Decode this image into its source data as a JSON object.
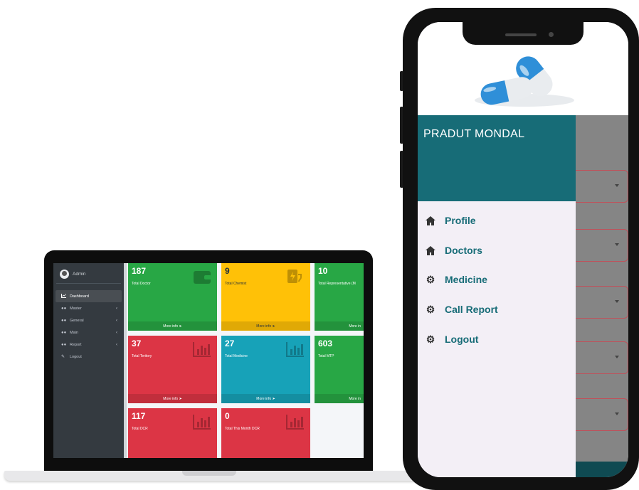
{
  "laptop": {
    "sidebar": {
      "user": "Admin",
      "items": [
        {
          "label": "Dashboard",
          "icon": "chart-icon",
          "active": true
        },
        {
          "label": "Master",
          "icon": "users-icon"
        },
        {
          "label": "General",
          "icon": "users-icon"
        },
        {
          "label": "Main",
          "icon": "users-icon"
        },
        {
          "label": "Report",
          "icon": "users-icon"
        },
        {
          "label": "Logout",
          "icon": "edit-icon"
        }
      ]
    },
    "boxes": [
      {
        "value": "187",
        "label": "Total Doctor",
        "more": "More info",
        "color": "#28a745",
        "icon": "wallet-icon"
      },
      {
        "value": "9",
        "label": "Total Chemist",
        "more": "More info",
        "color": "#ffc107",
        "icon": "charging-station-icon"
      },
      {
        "value": "10",
        "label": "Total Representative (M",
        "more": "More in",
        "color": "#28a745",
        "icon": ""
      },
      {
        "value": "37",
        "label": "Total Teritory",
        "more": "More info",
        "color": "#dc3545",
        "icon": "bar-chart-icon"
      },
      {
        "value": "27",
        "label": "Total Medicine",
        "more": "More info",
        "color": "#17a2b8",
        "icon": "bar-chart-icon"
      },
      {
        "value": "603",
        "label": "Total MTP",
        "more": "More in",
        "color": "#28a745",
        "icon": ""
      },
      {
        "value": "117",
        "label": "Total DCR",
        "more": "",
        "color": "#dc3545",
        "icon": "bar-chart-icon"
      },
      {
        "value": "0",
        "label": "Total This Month DCR",
        "more": "",
        "color": "#dc3545",
        "icon": "bar-chart-icon"
      }
    ]
  },
  "phone": {
    "drawer": {
      "user_name": "PRADUT MONDAL",
      "items": [
        {
          "label": "Profile",
          "icon": "home-icon"
        },
        {
          "label": "Doctors",
          "icon": "home-icon"
        },
        {
          "label": "Medicine",
          "icon": "gear-icon"
        },
        {
          "label": "Call Report",
          "icon": "gear-icon"
        },
        {
          "label": "Logout",
          "icon": "gear-icon"
        }
      ]
    },
    "accent_color": "#176c77"
  }
}
